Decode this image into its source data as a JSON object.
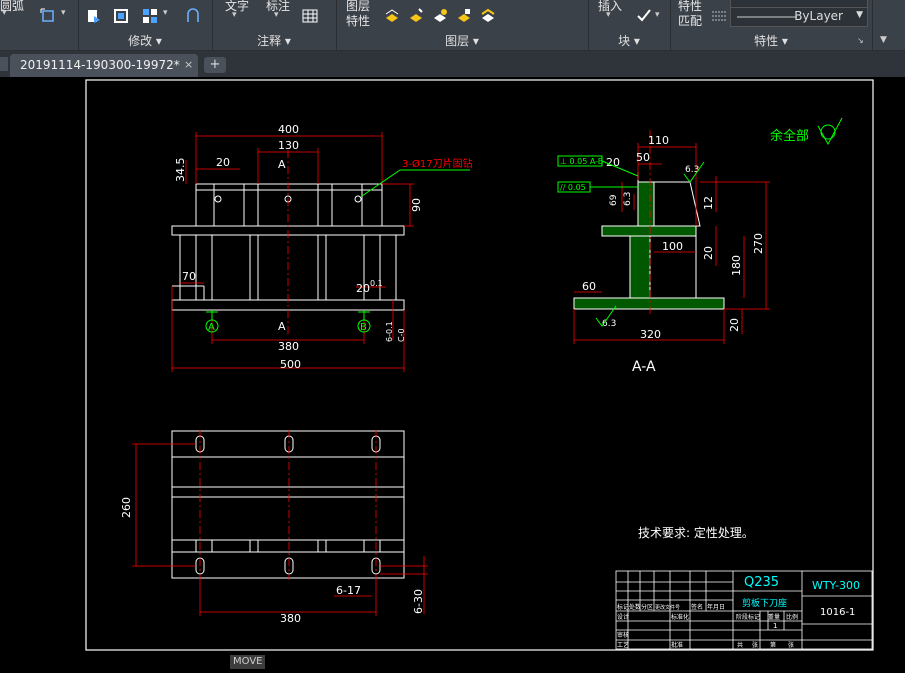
{
  "ribbon": {
    "top_labels": {
      "arc": "圆弧",
      "text": "文字",
      "dimension": "标注",
      "layer_props": [
        "图层",
        "特性"
      ],
      "insert": "插入",
      "match_props": [
        "特性",
        "匹配"
      ]
    },
    "panels": {
      "modify": "修改",
      "annotate": "注释",
      "layers": "图层",
      "block": "块",
      "properties": "特性"
    },
    "bylayer": "ByLayer"
  },
  "tabs": {
    "file": "20191114-190300-19972*",
    "close": "×",
    "new": "+"
  },
  "drawing": {
    "front": {
      "dim_400": "400",
      "dim_130": "130",
      "dim_20": "20",
      "dim_345": "34.5",
      "dim_90": "90",
      "dim_70": "70",
      "dim_20b": "20",
      "dim_01": "0.1",
      "dim_380": "380",
      "dim_500": "500",
      "dim_6_01": "6-0.1",
      "dim_vert": "C-0",
      "section_a": "A",
      "callout_holes": "3-Ø17刀片固钻",
      "datum_a": "A",
      "datum_b": "B"
    },
    "section": {
      "dim_110": "110",
      "dim_50": "50",
      "dim_20": "20",
      "dim_63": "6.3",
      "dim_69": "69",
      "dim_63b": "6.3",
      "dim_12": "12",
      "dim_100": "100",
      "dim_20b": "20",
      "dim_180": "180",
      "dim_270": "270",
      "dim_60": "60",
      "dim_63c": "6.3",
      "dim_320": "320",
      "dim_20c": "20",
      "gdt1": "⊥ 0.05 A-B",
      "gdt2": "// 0.05",
      "label": "A-A",
      "rough_rest": "余全部"
    },
    "plan": {
      "dim_260": "260",
      "dim_380": "380",
      "dim_617": "6-17",
      "dim_630": "6-30"
    },
    "tech_req": "技术要求: 定性处理。",
    "title_block": {
      "material": "Q235",
      "part_name": "剪板下刀座",
      "drawing_no": "WTY-300",
      "code": "1016-1",
      "small_1": "标记",
      "small_2": "处数",
      "small_3": "分区",
      "small_4": "更改文件号",
      "small_5": "签名",
      "small_6": "年月日",
      "small_7": "设计",
      "small_8": "标准化",
      "small_9": "阶段标记",
      "small_10": "重量",
      "small_11": "比例",
      "small_12": "审核",
      "small_13": "工艺",
      "small_14": "批准",
      "small_15": "共",
      "small_16": "张",
      "small_17": "第",
      "small_18": "张",
      "scale": "1"
    }
  },
  "command": "MOVE",
  "colors": {
    "ribbon": "#3b4148",
    "dim_red": "#ff0000",
    "green": "#00ff00",
    "white_line": "#ffffff",
    "cyan": "#00ffff",
    "yellow_green": "#7fff00"
  }
}
